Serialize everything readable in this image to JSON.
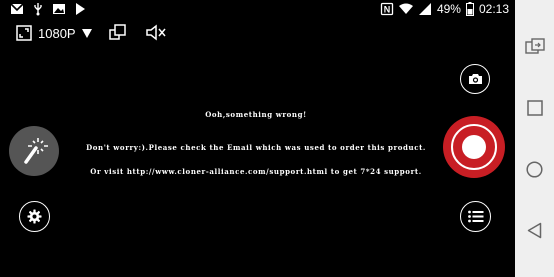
{
  "status_bar": {
    "left_icons": [
      "gmail-icon",
      "usb-icon",
      "gallery-icon",
      "play-store-icon"
    ],
    "right_icons": [
      "nfc-icon",
      "wifi-icon",
      "signal-icon"
    ],
    "battery": "49%",
    "time": "02:13"
  },
  "toolbar": {
    "resolution": "1080P",
    "icons": [
      "fullscreen-icon",
      "dropdown-triangle-icon",
      "pip-icon",
      "mute-icon"
    ]
  },
  "message": {
    "title": "Ooh,something wrong!",
    "line1": "Don't worry:).Please check the Email which was used to order this product.",
    "line2": "Or visit http://www.cloner-alliance.com/support.html to get 7*24 support."
  },
  "controls": {
    "left": [
      "magic-wand-icon",
      "settings-icon"
    ],
    "right": [
      "camera-icon",
      "record-icon",
      "list-icon"
    ],
    "accent_color": "#c81e24"
  },
  "nav_bar": {
    "items": [
      "switch-app-icon",
      "recents-icon",
      "home-icon",
      "back-icon"
    ],
    "background": "#efefef"
  }
}
